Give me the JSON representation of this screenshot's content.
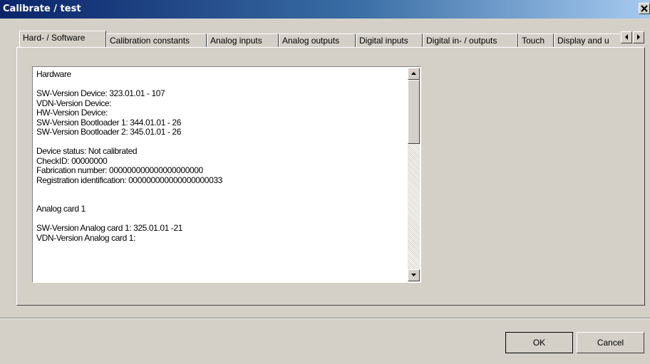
{
  "window": {
    "title": "Calibrate / test",
    "close_glyph": "✕"
  },
  "tabs": [
    {
      "label": "Hard- / Software",
      "active": true
    },
    {
      "label": "Calibration constants",
      "active": false
    },
    {
      "label": "Analog inputs",
      "active": false
    },
    {
      "label": "Analog outputs",
      "active": false
    },
    {
      "label": "Digital inputs",
      "active": false
    },
    {
      "label": "Digital in- / outputs",
      "active": false
    },
    {
      "label": "Touch",
      "active": false
    },
    {
      "label": "Display and u",
      "active": false
    }
  ],
  "tab_scroll": {
    "left_icon": "triangle-left-icon",
    "right_icon": "triangle-right-icon"
  },
  "info_text": {
    "lines": [
      "Hardware",
      "",
      "SW-Version Device: 323.01.01 - 107",
      "VDN-Version Device:",
      "HW-Version Device:",
      "SW-Version Bootloader 1: 344.01.01 - 26",
      "SW-Version Bootloader 2: 345.01.01 - 26",
      "",
      "Device status: Not calibrated",
      "CheckID: 00000000",
      "Fabrication number: 000000000000000000000",
      "Registration identification: 000000000000000000033",
      "",
      "",
      "Analog card 1",
      "",
      "SW-Version Analog card 1: 325.01.01 -21",
      "VDN-Version Analog card 1:"
    ]
  },
  "buttons": {
    "ok": "OK",
    "cancel": "Cancel"
  },
  "colors": {
    "titlebar_start": "#0a246a",
    "titlebar_end": "#a6caf0",
    "face": "#d4d0c8"
  }
}
